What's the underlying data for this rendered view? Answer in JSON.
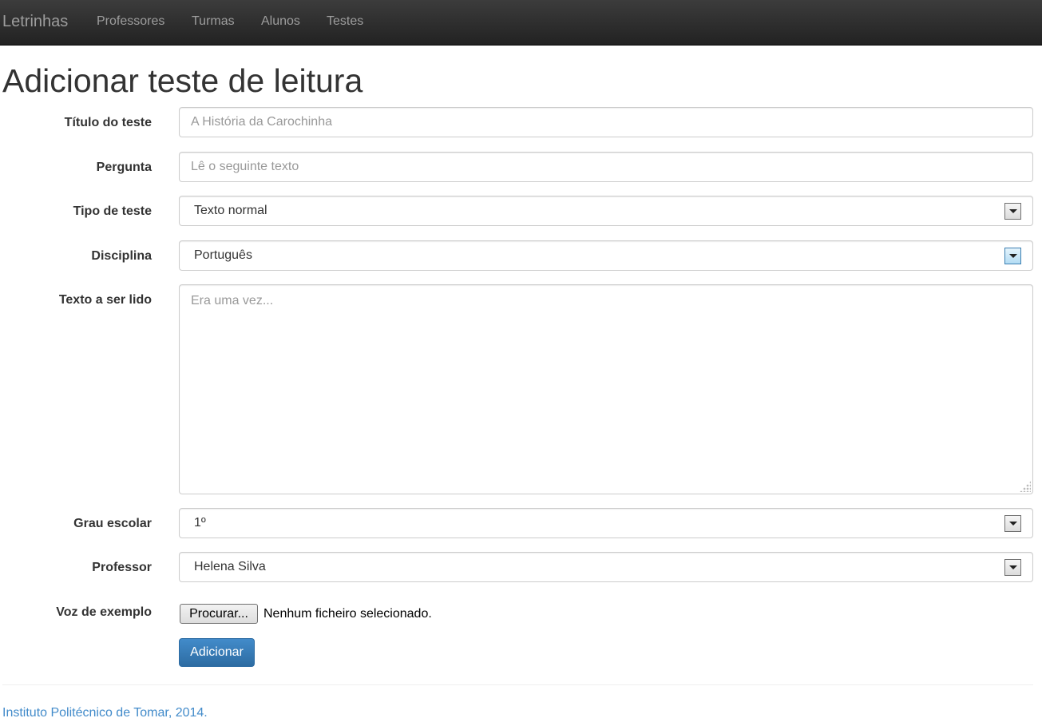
{
  "navbar": {
    "brand": "Letrinhas",
    "links": [
      "Professores",
      "Turmas",
      "Alunos",
      "Testes"
    ]
  },
  "page": {
    "title": "Adicionar teste de leitura"
  },
  "form": {
    "titulo": {
      "label": "Título do teste",
      "placeholder": "A História da Carochinha"
    },
    "pergunta": {
      "label": "Pergunta",
      "placeholder": "Lê o seguinte texto"
    },
    "tipo": {
      "label": "Tipo de teste",
      "value": "Texto normal"
    },
    "disciplina": {
      "label": "Disciplina",
      "value": "Português"
    },
    "texto": {
      "label": "Texto a ser lido",
      "placeholder": "Era uma vez..."
    },
    "grau": {
      "label": "Grau escolar",
      "value": "1º"
    },
    "professor": {
      "label": "Professor",
      "value": "Helena Silva"
    },
    "voz": {
      "label": "Voz de exemplo",
      "button": "Procurar...",
      "status": "Nenhum ficheiro selecionado."
    },
    "submit": "Adicionar"
  },
  "footer": {
    "text": "Instituto Politécnico de Tomar, 2014."
  },
  "colors": {
    "navbar": "#222222",
    "primary": "#428bca",
    "link": "#428bca"
  }
}
